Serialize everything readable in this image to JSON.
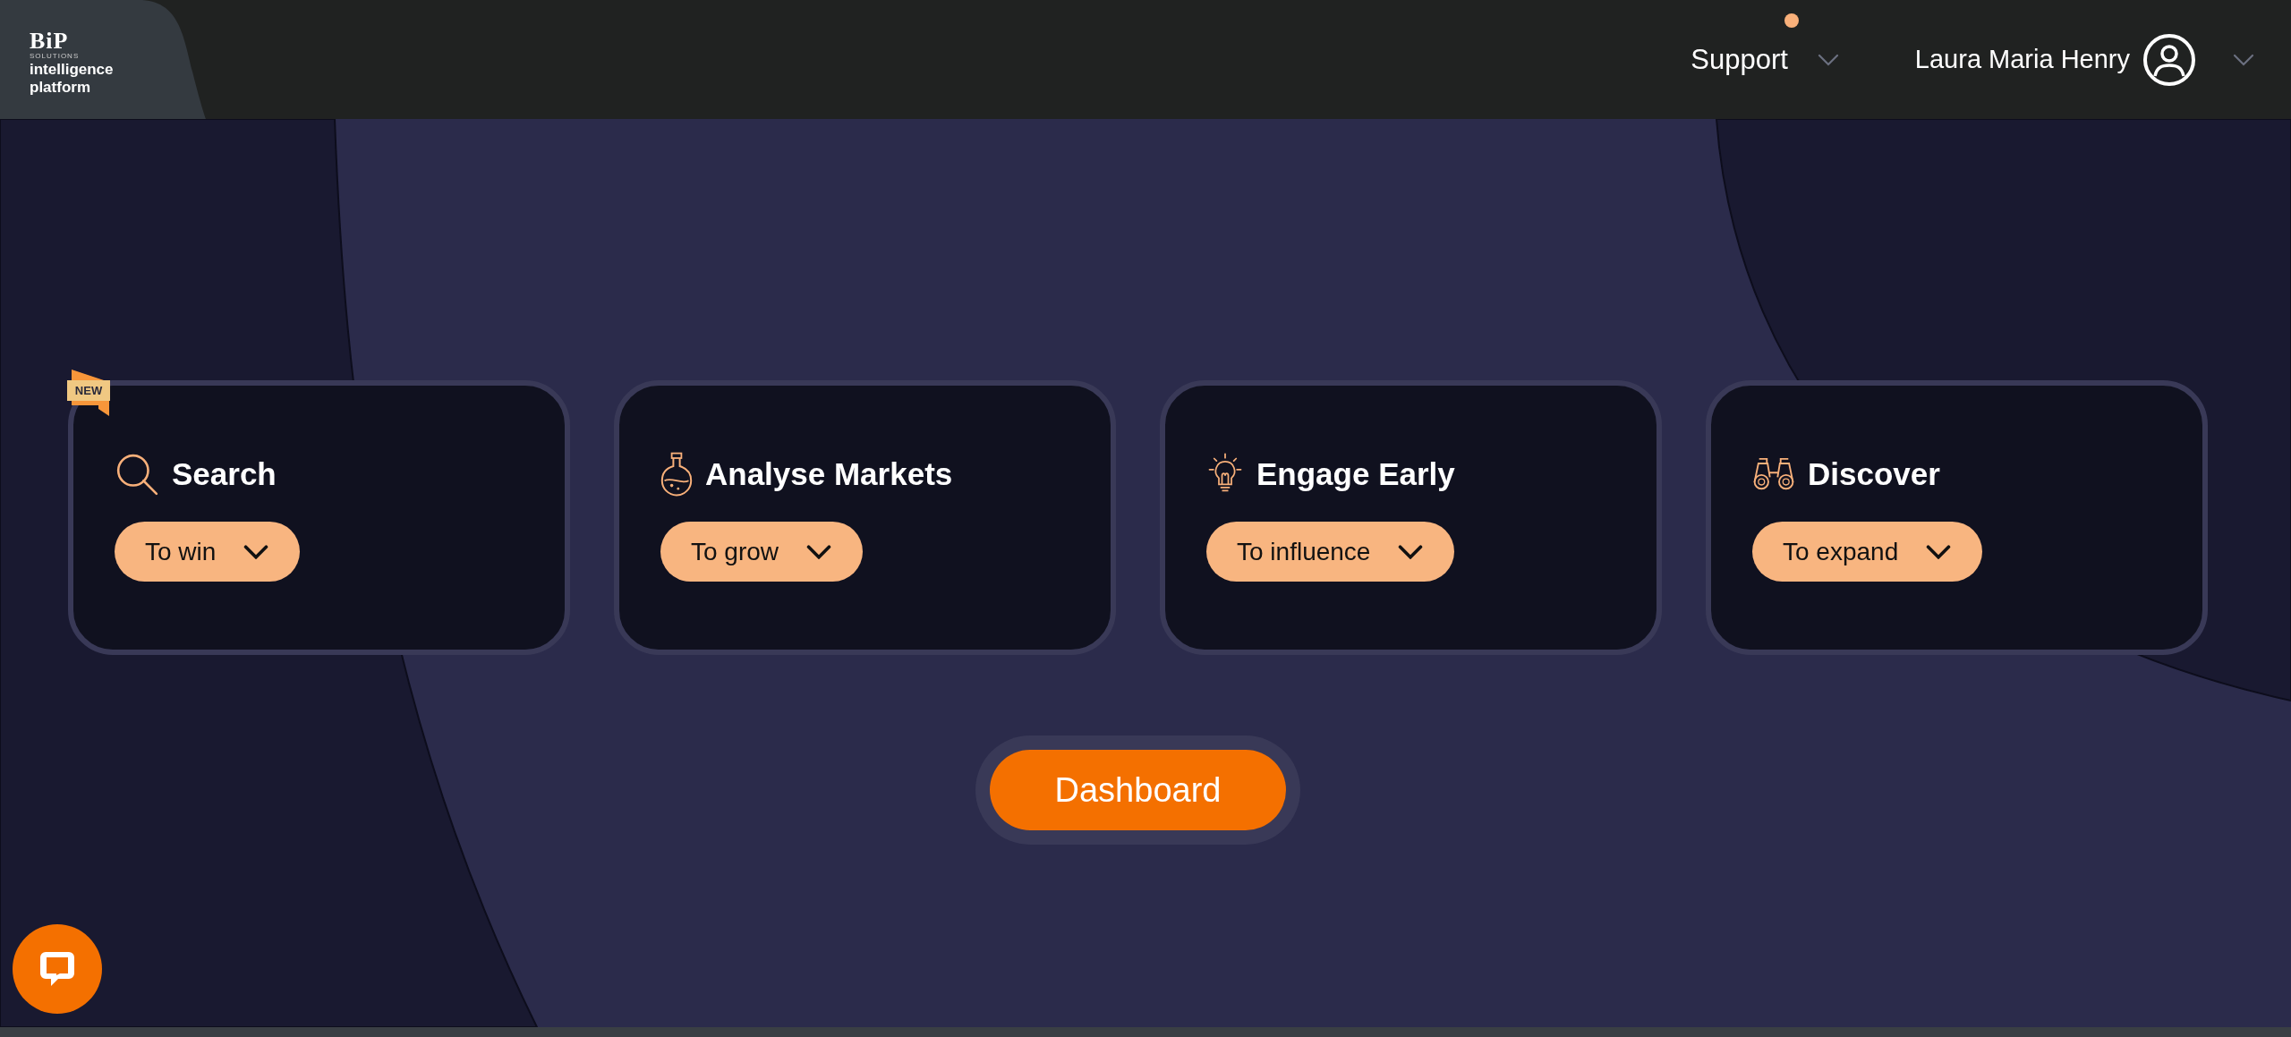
{
  "logo": {
    "brand": "BiP",
    "tagline": "SOLUTIONS",
    "product_lines": [
      "intelligence",
      "platform"
    ]
  },
  "header": {
    "support": {
      "label": "Support",
      "notification": true
    },
    "user": {
      "name": "Laura Maria Henry"
    }
  },
  "cards": [
    {
      "kind": "search",
      "title": "Search",
      "option": "To win",
      "badge": "NEW"
    },
    {
      "kind": "flask",
      "title": "Analyse Markets",
      "option": "To grow"
    },
    {
      "kind": "bulb",
      "title": "Engage Early",
      "option": "To influence"
    },
    {
      "kind": "binoculars",
      "title": "Discover",
      "option": "To expand"
    }
  ],
  "dashboard_button": "Dashboard"
}
